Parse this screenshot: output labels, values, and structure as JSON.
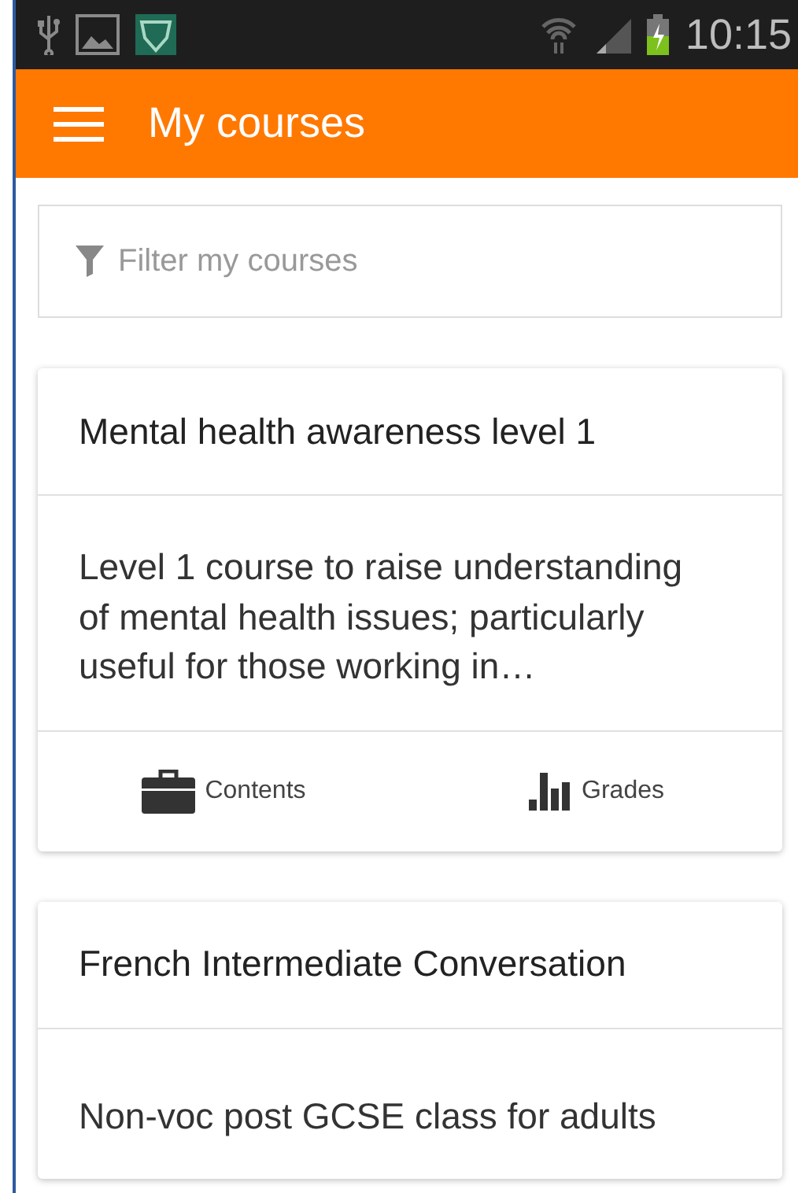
{
  "status_bar": {
    "time": "10:15"
  },
  "app_bar": {
    "title": "My courses"
  },
  "filter": {
    "placeholder": "Filter my courses"
  },
  "courses": [
    {
      "title": "Mental health awareness level 1",
      "summary": "Level 1 course to raise understanding of mental health issues; particularly useful for those working in…",
      "actions": [
        {
          "kind": "contents",
          "label": "Contents"
        },
        {
          "kind": "grades",
          "label": "Grades"
        }
      ]
    },
    {
      "title": "French Intermediate Conversation",
      "summary": "Non-voc post GCSE class for adults"
    }
  ]
}
